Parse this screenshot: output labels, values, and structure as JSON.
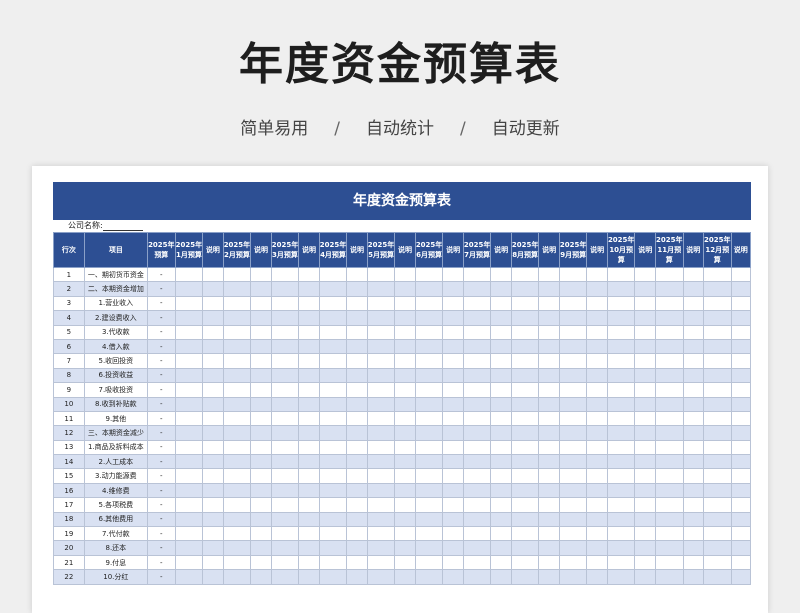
{
  "hero": {
    "title": "年度资金预算表",
    "tags": [
      "简单易用",
      "自动统计",
      "自动更新"
    ],
    "separator": "/"
  },
  "sheet": {
    "banner": "年度资金预算表",
    "company_label": "公司名称:",
    "headers": [
      "行次",
      "项目",
      "2025年预算",
      "2025年1月预算",
      "说明",
      "2025年2月预算",
      "说明",
      "2025年3月预算",
      "说明",
      "2025年4月预算",
      "说明",
      "2025年5月预算",
      "说明",
      "2025年6月预算",
      "说明",
      "2025年7月预算",
      "说明",
      "2025年8月预算",
      "说明",
      "2025年9月预算",
      "说明",
      "2025年10月预算",
      "说明",
      "2025年11月预算",
      "说明",
      "2025年12月预算",
      "说明"
    ],
    "rows": [
      {
        "no": "1",
        "item": "一、期初货币资金",
        "budget": "-"
      },
      {
        "no": "2",
        "item": "二、本期资金增加",
        "budget": "-"
      },
      {
        "no": "3",
        "item": "1.营业收入",
        "budget": "-"
      },
      {
        "no": "4",
        "item": "2.建设费收入",
        "budget": "-"
      },
      {
        "no": "5",
        "item": "3.代收款",
        "budget": "-"
      },
      {
        "no": "6",
        "item": "4.借入款",
        "budget": "-"
      },
      {
        "no": "7",
        "item": "5.收回投资",
        "budget": "-"
      },
      {
        "no": "8",
        "item": "6.投资收益",
        "budget": "-"
      },
      {
        "no": "9",
        "item": "7.吸收投资",
        "budget": "-"
      },
      {
        "no": "10",
        "item": "8.收到补贴款",
        "budget": "-"
      },
      {
        "no": "11",
        "item": "9.其他",
        "budget": "-"
      },
      {
        "no": "12",
        "item": "三、本期资金减少",
        "budget": "-"
      },
      {
        "no": "13",
        "item": "1.商品及拆料成本",
        "budget": "-"
      },
      {
        "no": "14",
        "item": "2.人工成本",
        "budget": "-"
      },
      {
        "no": "15",
        "item": "3.动力能源费",
        "budget": "-"
      },
      {
        "no": "16",
        "item": "4.维修费",
        "budget": "-"
      },
      {
        "no": "17",
        "item": "5.各项税费",
        "budget": "-"
      },
      {
        "no": "18",
        "item": "6.其他费用",
        "budget": "-"
      },
      {
        "no": "19",
        "item": "7.代付款",
        "budget": "-"
      },
      {
        "no": "20",
        "item": "8.还本",
        "budget": "-"
      },
      {
        "no": "21",
        "item": "9.付息",
        "budget": "-"
      },
      {
        "no": "22",
        "item": "10.分红",
        "budget": "-"
      }
    ]
  }
}
